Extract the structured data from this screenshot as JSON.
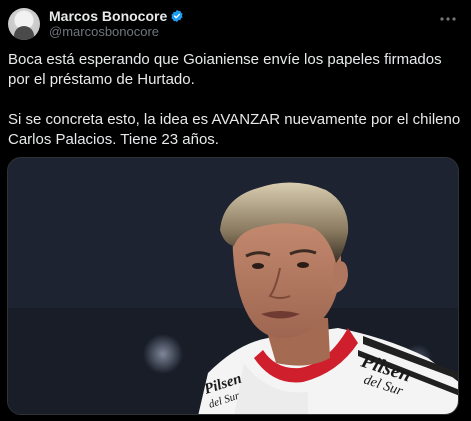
{
  "tweet": {
    "author": {
      "display_name": "Marcos Bonocore",
      "handle": "@marcosbonocore",
      "verified": true
    },
    "more_icon": "more-horizontal-icon",
    "text_paragraph_1": "Boca está esperando que Goianiense envíe los papeles firmados por el préstamo de Hurtado.",
    "text_paragraph_2": "Si se concreta esto, la idea es AVANZAR nuevamente por el chileno Carlos Palacios. Tiene 23 años.",
    "media": {
      "jersey_text_left": "Pilsen del Sur",
      "jersey_text_right": "Pilsen del Sur"
    }
  },
  "colors": {
    "background": "#000000",
    "text": "#e7e9ea",
    "secondary_text": "#71767b",
    "verified_blue": "#1d9bf0"
  }
}
